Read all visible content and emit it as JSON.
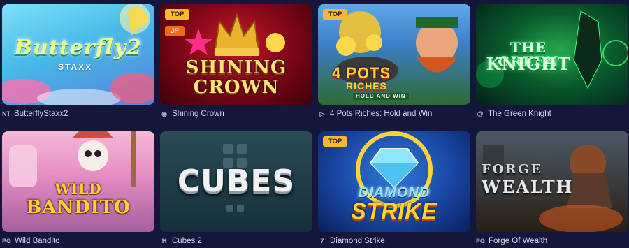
{
  "games": [
    {
      "title": "ButterflyStaxx2",
      "provider_icon": "NT",
      "art_line1": "Butterfly2",
      "art_line2": "STAXX",
      "badges": []
    },
    {
      "title": "Shining Crown",
      "provider_icon": "eye-icon",
      "art_line1": "SHINING",
      "art_line2": "CROWN",
      "badges": [
        "TOP",
        "JP"
      ]
    },
    {
      "title": "4 Pots Riches: Hold and Win",
      "provider_icon": "play-triangle-icon",
      "art_line1": "4 POTS",
      "art_line2": "RICHES",
      "art_line3": "HOLD AND WIN",
      "badges": [
        "TOP"
      ]
    },
    {
      "title": "The Green Knight",
      "provider_icon": "at-icon",
      "art_line1": "THE GREEN",
      "art_line2": "KNIGHT",
      "badges": []
    },
    {
      "title": "Wild Bandito",
      "provider_icon": "PG",
      "art_line1": "WILD",
      "art_line2": "BANDITO",
      "badges": []
    },
    {
      "title": "Cubes 2",
      "provider_icon": "H",
      "art_line1": "CUBES",
      "badges": []
    },
    {
      "title": "Diamond Strike",
      "provider_icon": "7",
      "art_line1": "DIAMOND",
      "art_line2": "STRIKE",
      "badges": [
        "TOP"
      ]
    },
    {
      "title": "Forge Of Wealth",
      "provider_icon": "PG",
      "art_line1": "FORGE",
      "art_line2": "WEALTH",
      "badges": []
    }
  ],
  "colors": {
    "page_bg": "#14173a",
    "caption_text": "#d4d7ec",
    "badge_top": "#f7b932",
    "badge_jp": "#f06a14"
  }
}
